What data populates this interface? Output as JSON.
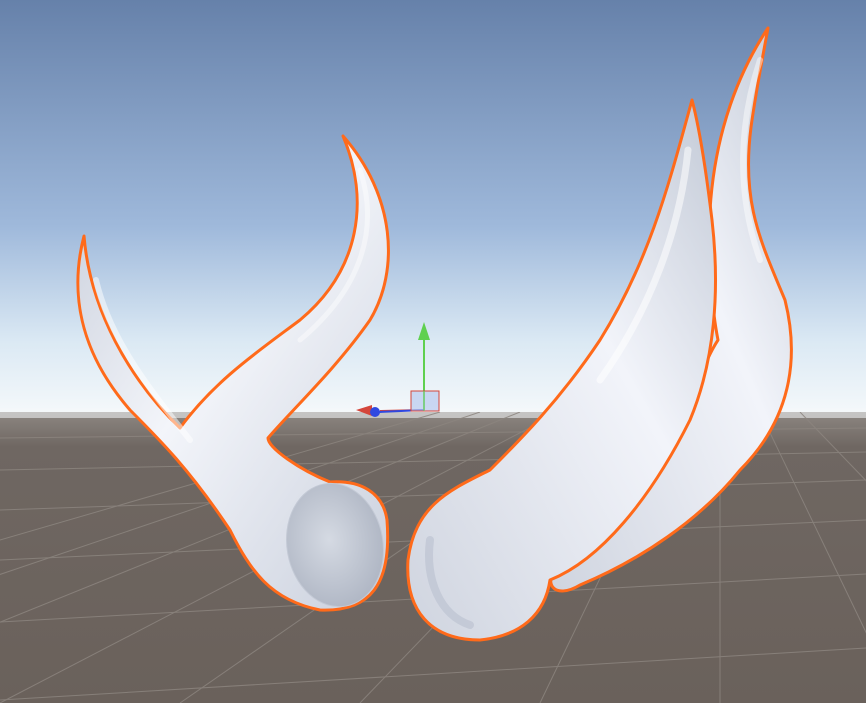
{
  "scene": {
    "view": "scene-viewport",
    "sky": {
      "top_color": "#6681aa",
      "mid_color": "#9fb9db",
      "horizon_color": "#e6f0f6"
    },
    "ground": {
      "color": "#6e6660",
      "grid_color": "#8a837d"
    },
    "selection_outline_color": "#ff6a1a",
    "model_color": "#e8ecf5",
    "objects": [
      {
        "name": "horn-left",
        "selected": true
      },
      {
        "name": "horn-right",
        "selected": true
      }
    ],
    "gizmo": {
      "y_axis_color": "#5fd04f",
      "x_axis_color": "#d4463b",
      "z_axis_color": "#2f48e0",
      "center_handle_color": "#b8c9ef"
    }
  }
}
